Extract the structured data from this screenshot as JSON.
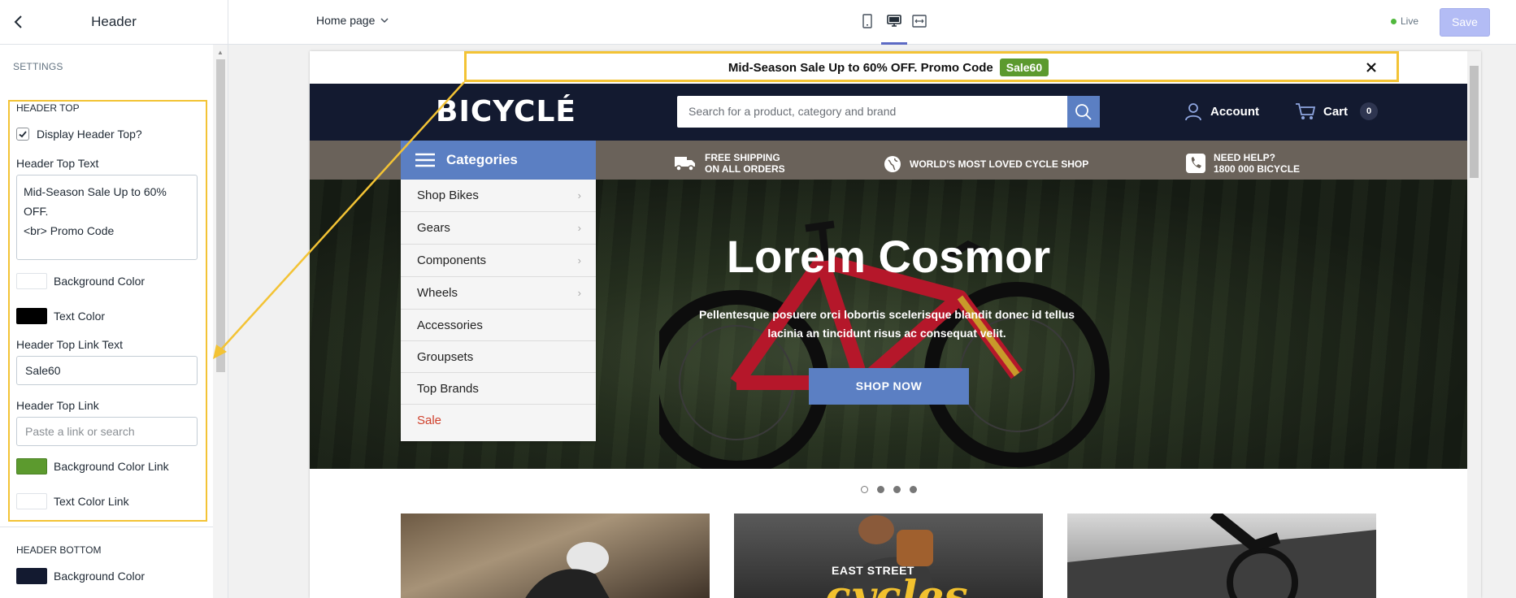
{
  "sidebar": {
    "title": "Header",
    "section_label": "SETTINGS",
    "header_top": {
      "group_title": "HEADER TOP",
      "display_label": "Display Header Top?",
      "display_checked": true,
      "text_label": "Header Top Text",
      "text_value": "Mid-Season Sale Up to 60% OFF.\n<br> Promo Code",
      "bg_color_label": "Background Color",
      "bg_color": "#ffffff",
      "text_color_label": "Text Color",
      "text_color": "#000000",
      "link_text_label": "Header Top Link Text",
      "link_text_value": "Sale60",
      "link_label": "Header Top Link",
      "link_placeholder": "Paste a link or search",
      "bg_color_link_label": "Background Color Link",
      "bg_color_link": "#5c9a2e",
      "text_color_link_label": "Text Color Link",
      "text_color_link": "#ffffff"
    },
    "header_bottom": {
      "group_title": "HEADER BOTTOM",
      "bg_color_label": "Background Color",
      "bg_color": "#131a30"
    }
  },
  "topbar": {
    "page_select": "Home page",
    "devices": [
      "mobile-icon",
      "desktop-icon",
      "fullwidth-icon"
    ],
    "active_device": "desktop-icon",
    "status": "Live",
    "save_label": "Save"
  },
  "preview": {
    "announcement": {
      "text": "Mid-Season Sale Up to 60% OFF. Promo Code",
      "promo": "Sale60"
    },
    "header": {
      "logo": "BICYCLÉ",
      "search_placeholder": "Search for a product, category and brand",
      "account_label": "Account",
      "cart_label": "Cart",
      "cart_count": "0"
    },
    "categories_label": "Categories",
    "info": [
      {
        "icon": "truck-icon",
        "line1": "FREE SHIPPING",
        "line2": "ON ALL ORDERS"
      },
      {
        "icon": "globe-icon",
        "line1": "WORLD'S MOST LOVED CYCLE SHOP",
        "line2": ""
      },
      {
        "icon": "phone-icon",
        "line1": "NEED HELP?",
        "line2": "1800 000 BICYCLE"
      }
    ],
    "menu": [
      {
        "label": "Shop Bikes",
        "has_children": true
      },
      {
        "label": "Gears",
        "has_children": true
      },
      {
        "label": "Components",
        "has_children": true
      },
      {
        "label": "Wheels",
        "has_children": true
      },
      {
        "label": "Accessories",
        "has_children": false
      },
      {
        "label": "Groupsets",
        "has_children": false
      },
      {
        "label": "Top Brands",
        "has_children": false
      },
      {
        "label": "Sale",
        "has_children": false
      }
    ],
    "hero": {
      "title": "Lorem Cosmor",
      "subtitle": "Pellentesque posuere orci lobortis scelerisque blandit donec id tellus lacinia an tincidunt risus ac consequat velit.",
      "button": "SHOP NOW"
    },
    "slider": {
      "count": 4,
      "active": 0
    },
    "tiles": [
      {
        "caption": ""
      },
      {
        "caption": "EAST STREET",
        "script": "cycles"
      },
      {
        "caption": ""
      }
    ]
  }
}
